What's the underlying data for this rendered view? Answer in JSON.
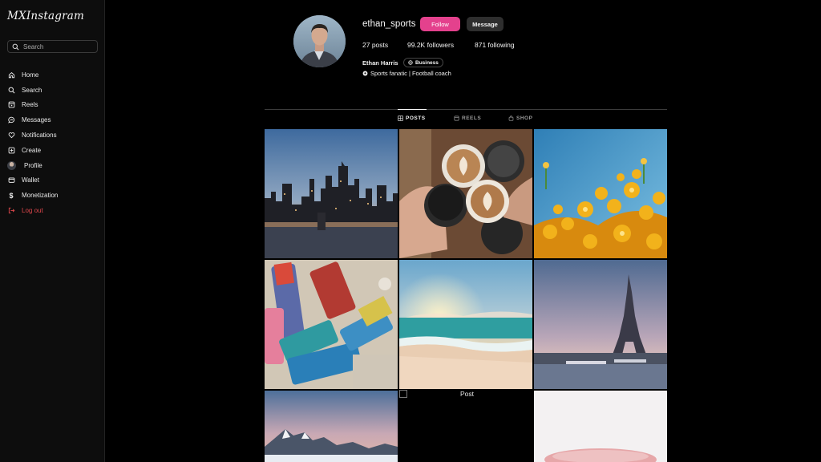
{
  "app": {
    "logo": "MXInstagram",
    "search_placeholder": "Search"
  },
  "sidebar": {
    "items": [
      {
        "label": "Home",
        "icon": "home-icon"
      },
      {
        "label": "Search",
        "icon": "search-icon"
      },
      {
        "label": "Reels",
        "icon": "reels-icon"
      },
      {
        "label": "Messages",
        "icon": "messages-icon"
      },
      {
        "label": "Notifications",
        "icon": "heart-icon"
      },
      {
        "label": "Create",
        "icon": "plus-square-icon"
      },
      {
        "label": "Profile",
        "icon": "avatar"
      },
      {
        "label": "Wallet",
        "icon": "wallet-icon"
      },
      {
        "label": "Monetization",
        "icon": "dollar-icon"
      },
      {
        "label": "Log out",
        "icon": "logout-icon"
      }
    ],
    "logout_color": "#e0474c"
  },
  "profile": {
    "username": "ethan_sports",
    "follow_label": "Follow",
    "message_label": "Message",
    "posts": "27 posts",
    "followers": "99.2K followers",
    "following": "871 following",
    "full_name": "Ethan Harris",
    "badge": "Business",
    "bio": "Sports fanatic | Football coach",
    "accent": "#e4418d"
  },
  "tabs": [
    {
      "label": "POSTS",
      "icon": "grid-icon",
      "active": true
    },
    {
      "label": "REELS",
      "icon": "reels-icon",
      "active": false
    },
    {
      "label": "SHOP",
      "icon": "shop-icon",
      "active": false
    }
  ],
  "posts": [
    {
      "subject": "city-skyline-sunset"
    },
    {
      "subject": "latte-cups-toast"
    },
    {
      "subject": "yellow-flowers"
    },
    {
      "subject": "paint-brushes"
    },
    {
      "subject": "beach-sunset"
    },
    {
      "subject": "eiffel-tower"
    },
    {
      "subject": "mountain-peaks"
    },
    {
      "subject": "broken-image",
      "alt": "Post"
    },
    {
      "subject": "pale-pink-blur"
    }
  ]
}
